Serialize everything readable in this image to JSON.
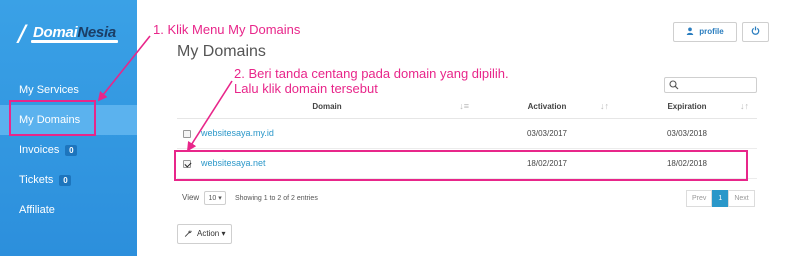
{
  "logo": {
    "text_prefix": "Domai",
    "text_suffix": "Nesia"
  },
  "sidebar": {
    "items": [
      {
        "label": "My Services"
      },
      {
        "label": "My Domains"
      },
      {
        "label": "Invoices",
        "badge": "0"
      },
      {
        "label": "Tickets",
        "badge": "0"
      },
      {
        "label": "Affiliate"
      }
    ]
  },
  "header": {
    "title": "My Domains",
    "profile_label": "profile",
    "profile_icon": "user-icon",
    "power_icon": "power-icon"
  },
  "search": {
    "icon": "search-icon"
  },
  "table": {
    "columns": [
      "Domain",
      "Activation",
      "Expiration"
    ],
    "rows": [
      {
        "domain": "websitesaya.my.id",
        "activation": "03/03/2017",
        "expiration": "03/03/2018",
        "checked": false
      },
      {
        "domain": "websitesaya.net",
        "activation": "18/02/2017",
        "expiration": "18/02/2018",
        "checked": true
      }
    ]
  },
  "length": {
    "label": "View",
    "value": "10",
    "info": "Showing 1 to 2 of 2 entries"
  },
  "pager": {
    "prev": "Prev",
    "current": "1",
    "next": "Next"
  },
  "action": {
    "label": "Action"
  },
  "annotations": {
    "step1": "1. Klik Menu My Domains",
    "step2_line1": "2. Beri tanda centang pada domain yang dipilih.",
    "step2_line2": "Lalu klik domain tersebut",
    "color": "#e8268a"
  },
  "colors": {
    "sidebar": "#3aa1e6",
    "active": "#5bb2ee",
    "link": "#2a97c9"
  }
}
